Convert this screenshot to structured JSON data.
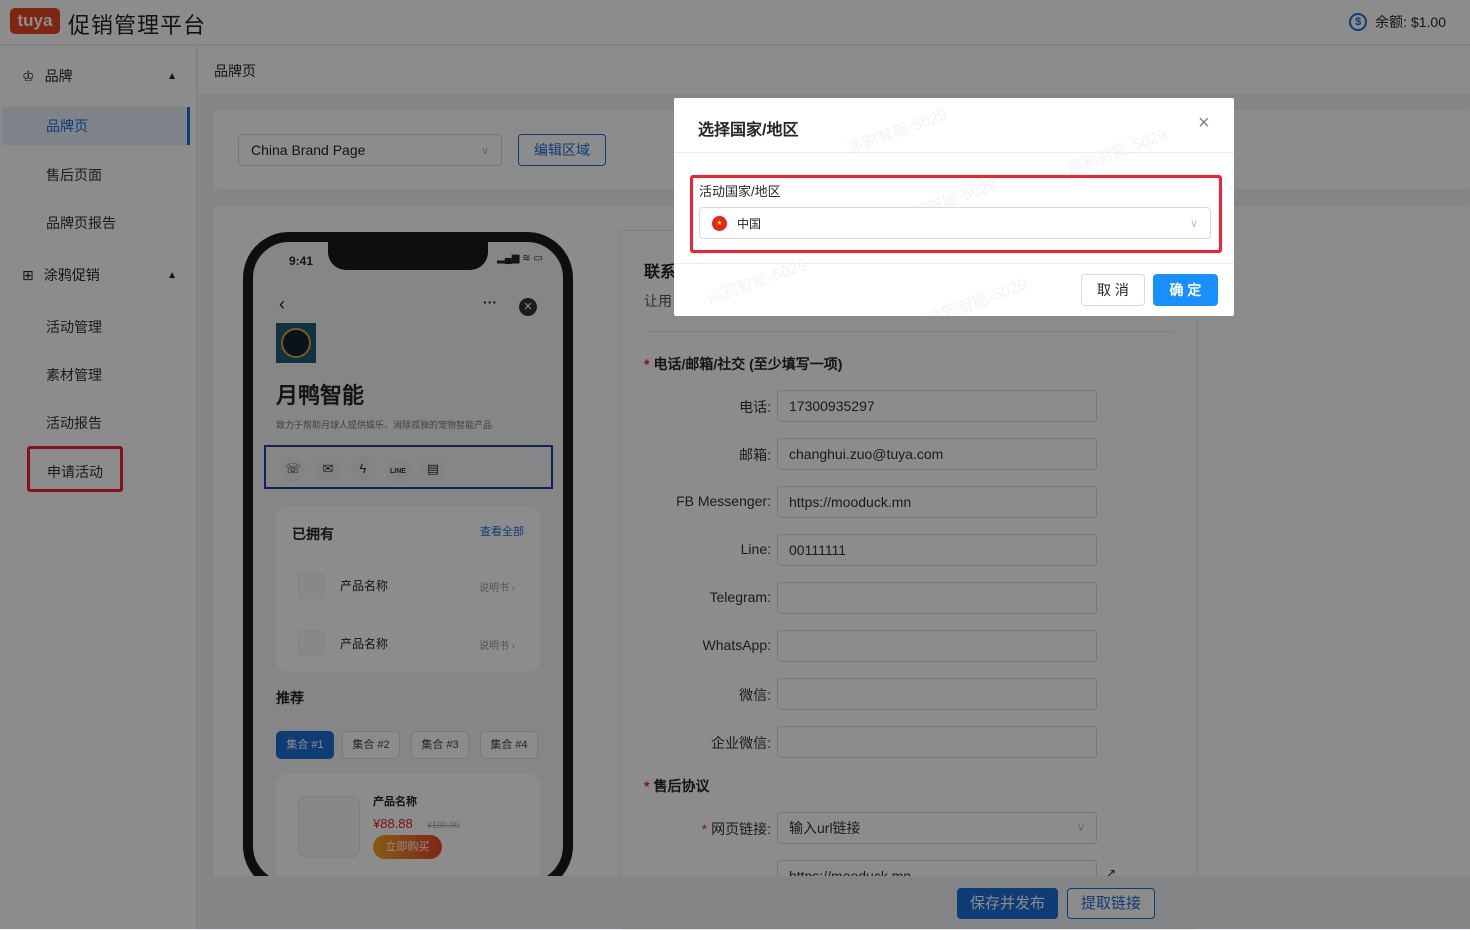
{
  "header": {
    "logo": "tuya",
    "title": "促销管理平台",
    "balance_icon": "dollar-circle-icon",
    "balance": "余额: $1.00"
  },
  "sidebar": {
    "groups": [
      {
        "label": "品牌",
        "icon": "crown-icon",
        "items": [
          "品牌页",
          "售后页面",
          "品牌页报告"
        ]
      },
      {
        "label": "涂鸦促销",
        "icon": "gift-icon",
        "items": [
          "活动管理",
          "素材管理",
          "活动报告",
          "申请活动"
        ]
      }
    ],
    "active": "品牌页",
    "highlighted": "申请活动"
  },
  "breadcrumb": "品牌页",
  "toolbar": {
    "brand_select": "China Brand Page",
    "edit_region": "编辑区域"
  },
  "phone": {
    "time": "9:41",
    "brand_name": "月鸭智能",
    "slogan": "致力于帮助月球人提供娱乐、消除孤独的宠物智能产品",
    "contact_icons": [
      "phone-icon",
      "mail-icon",
      "messenger-icon",
      "line-icon",
      "wallet-icon"
    ],
    "owned_title": "已拥有",
    "view_all": "查看全部",
    "owned": [
      {
        "name": "产品名称",
        "manual": "说明书"
      },
      {
        "name": "产品名称",
        "manual": "说明书"
      }
    ],
    "recommend_title": "推荐",
    "tags": [
      "集合 #1",
      "集合 #2",
      "集合 #3",
      "集合 #4"
    ],
    "product": {
      "name": "产品名称",
      "price": "¥88.88",
      "original_price": "¥100.00",
      "buy": "立即购买"
    }
  },
  "form": {
    "section_title": "联系",
    "section_desc": "让用",
    "contact_heading": "电话/邮箱/社交 (至少填写一项)",
    "fields": [
      {
        "label": "电话",
        "value": "17300935297"
      },
      {
        "label": "邮箱",
        "value": "changhui.zuo@tuya.com"
      },
      {
        "label": "FB Messenger",
        "value": "https://mooduck.mn"
      },
      {
        "label": "Line",
        "value": "00111111"
      },
      {
        "label": "Telegram",
        "value": ""
      },
      {
        "label": "WhatsApp",
        "value": ""
      },
      {
        "label": "微信",
        "value": ""
      },
      {
        "label": "企业微信",
        "value": ""
      }
    ],
    "after_sales_heading": "售后协议",
    "web_link_label": "网页链接",
    "web_link_select": "输入url链接",
    "web_link_value": "https://mooduck.mn"
  },
  "actions": {
    "save_publish": "保存并发布",
    "extract_link": "提取链接"
  },
  "modal": {
    "title": "选择国家/地区",
    "field_label": "活动国家/地区",
    "country": "中国",
    "cancel": "取 消",
    "ok": "确 定",
    "watermark": "涂鸦智能-5029"
  }
}
